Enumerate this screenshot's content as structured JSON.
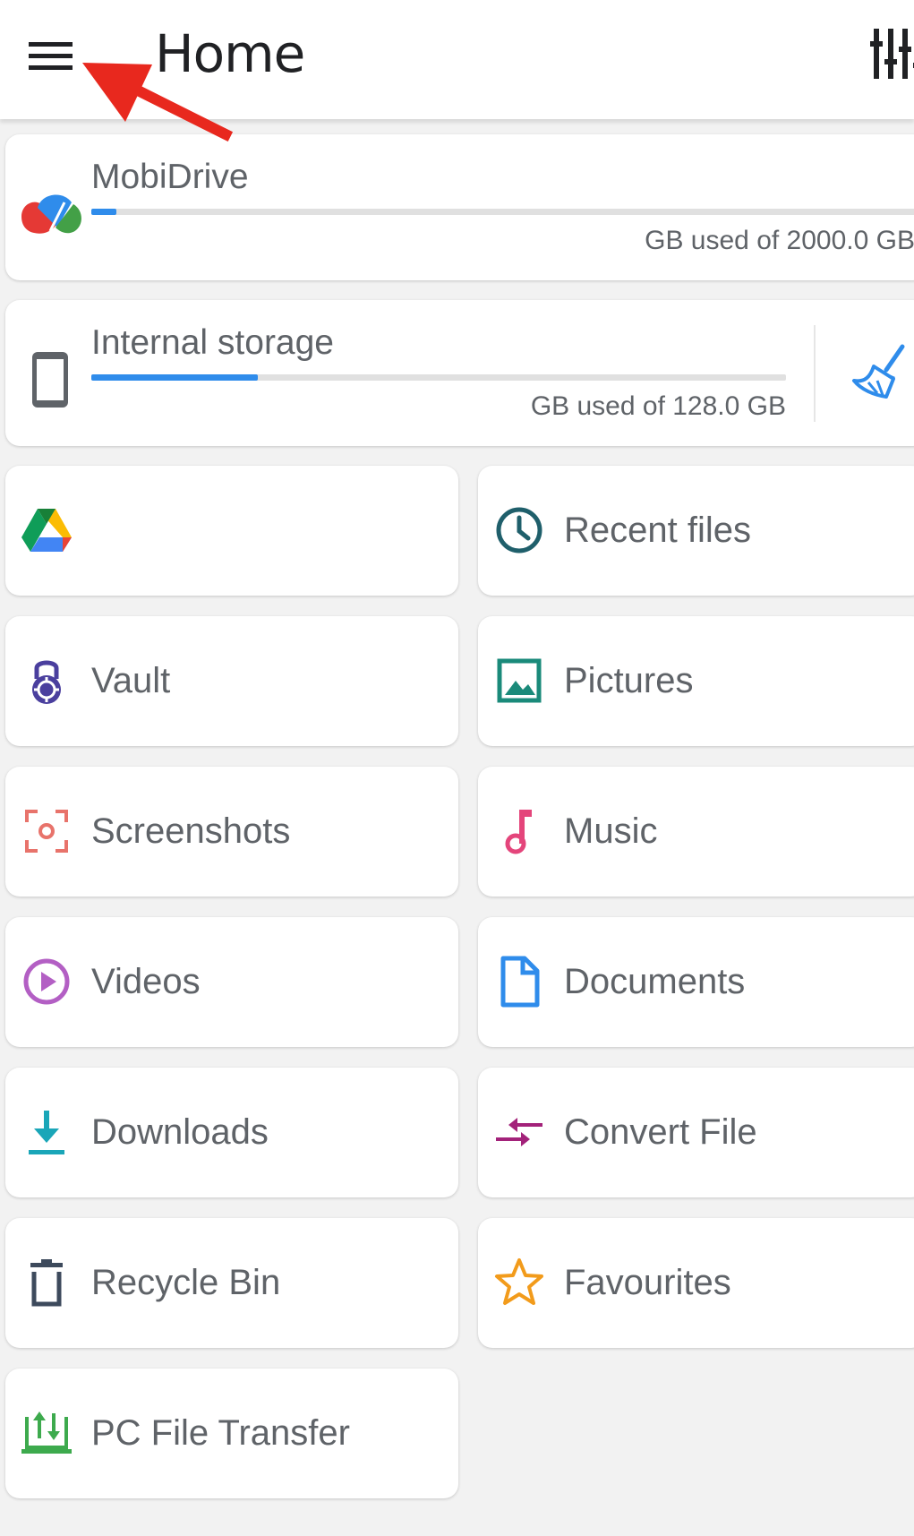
{
  "header": {
    "title": "Home",
    "menu_icon": "hamburger-menu-icon",
    "filter_icon": "tune-sliders-icon"
  },
  "storage": {
    "cloud": {
      "name": "MobiDrive",
      "used_text": "GB used of 2000.0 GB",
      "used_fraction": 0.03,
      "icon": "mobidrive-logo-icon"
    },
    "internal": {
      "name": "Internal storage",
      "used_text": "GB used of 128.0 GB",
      "used_fraction": 0.24,
      "icon": "phone-icon",
      "action_icon": "broom-clean-icon"
    }
  },
  "tiles": [
    {
      "label": "",
      "icon": "google-drive-icon"
    },
    {
      "label": "Recent files",
      "icon": "clock-icon"
    },
    {
      "label": "Vault",
      "icon": "lock-icon"
    },
    {
      "label": "Pictures",
      "icon": "image-icon"
    },
    {
      "label": "Screenshots",
      "icon": "screenshot-icon"
    },
    {
      "label": "Music",
      "icon": "music-note-icon"
    },
    {
      "label": "Videos",
      "icon": "play-circle-icon"
    },
    {
      "label": "Documents",
      "icon": "document-icon"
    },
    {
      "label": "Downloads",
      "icon": "download-icon"
    },
    {
      "label": "Convert File",
      "icon": "convert-arrows-icon"
    },
    {
      "label": "Recycle Bin",
      "icon": "trash-icon"
    },
    {
      "label": "Favourites",
      "icon": "star-icon"
    },
    {
      "label": "PC File Transfer",
      "icon": "pc-transfer-icon"
    }
  ],
  "colors": {
    "accent_blue": "#2f8ceb",
    "annotation_arrow": "#e8281e"
  }
}
